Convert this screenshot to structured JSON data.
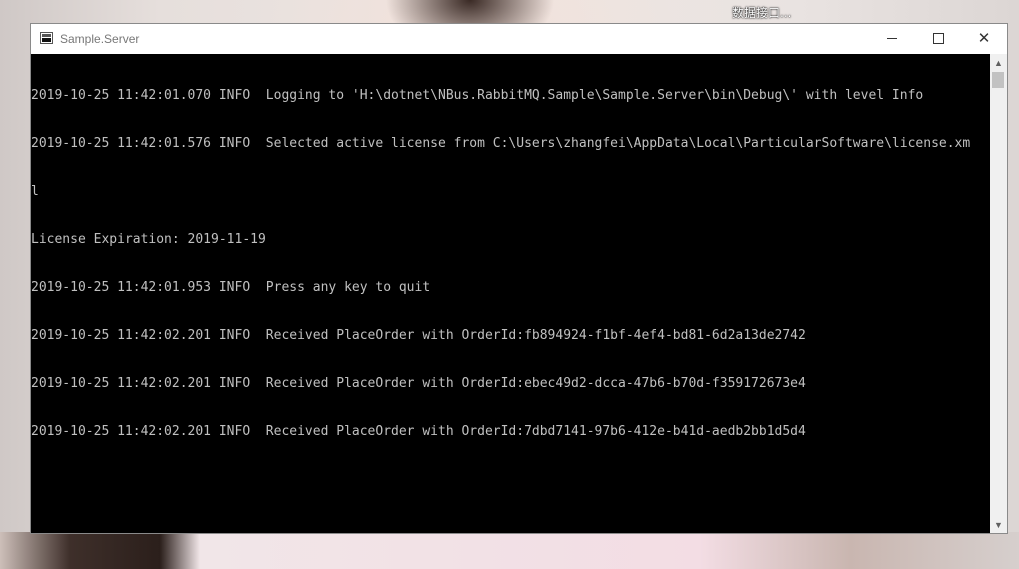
{
  "desktop": {
    "icon_label": "数据接口..."
  },
  "window": {
    "title": "Sample.Server",
    "icon": "console-app-icon",
    "controls": {
      "minimize_icon": "minimize-icon",
      "maximize_icon": "maximize-icon",
      "close_icon": "close-icon",
      "close_glyph": "✕"
    }
  },
  "console": {
    "background": "#000000",
    "foreground": "#c0c0c0",
    "lines": [
      "2019-10-25 11:42:01.070 INFO  Logging to 'H:\\dotnet\\NBus.RabbitMQ.Sample\\Sample.Server\\bin\\Debug\\' with level Info",
      "2019-10-25 11:42:01.576 INFO  Selected active license from C:\\Users\\zhangfei\\AppData\\Local\\ParticularSoftware\\license.xm",
      "l",
      "License Expiration: 2019-11-19",
      "2019-10-25 11:42:01.953 INFO  Press any key to quit",
      "2019-10-25 11:42:02.201 INFO  Received PlaceOrder with OrderId:fb894924-f1bf-4ef4-bd81-6d2a13de2742",
      "2019-10-25 11:42:02.201 INFO  Received PlaceOrder with OrderId:ebec49d2-dcca-47b6-b70d-f359172673e4",
      "2019-10-25 11:42:02.201 INFO  Received PlaceOrder with OrderId:7dbd7141-97b6-412e-b41d-aedb2bb1d5d4"
    ]
  },
  "scrollbar": {
    "up_glyph": "▲",
    "down_glyph": "▼"
  }
}
